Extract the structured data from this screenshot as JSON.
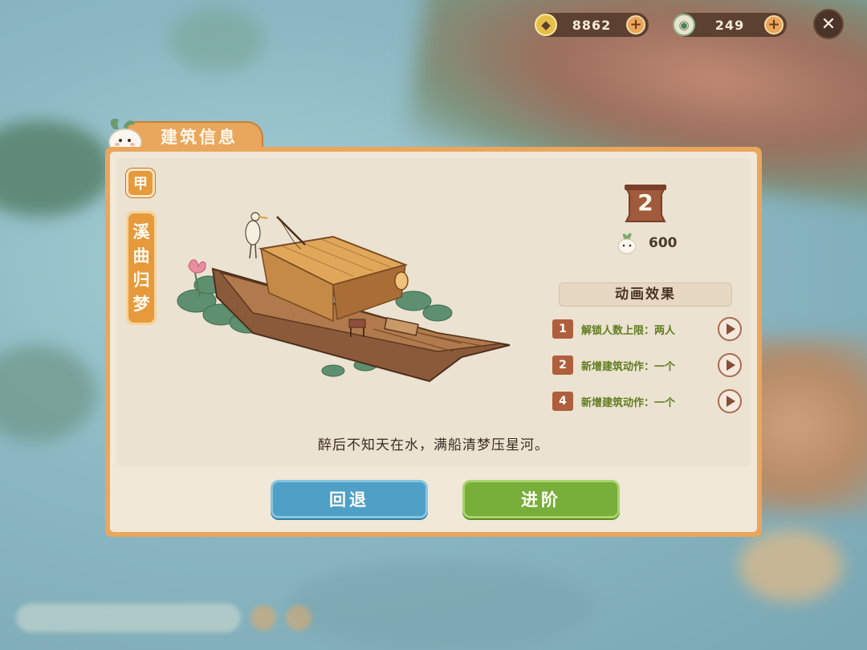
{
  "currency": {
    "coins": "8862",
    "jade": "249",
    "coin_icon": "coin-icon",
    "jade_icon": "jade-coin-icon",
    "plus_label": "+"
  },
  "close_icon": "close-icon",
  "panel": {
    "title": "建筑信息",
    "grade": "甲",
    "name_chars": [
      "溪",
      "曲",
      "归",
      "梦"
    ],
    "level": "2",
    "cost": "600",
    "effects_title": "动画效果",
    "effects": [
      {
        "num": "1",
        "text": "解锁人数上限：两人"
      },
      {
        "num": "2",
        "text": "新增建筑动作：一个"
      },
      {
        "num": "4",
        "text": "新增建筑动作：一个"
      }
    ],
    "poem": "醉后不知天在水，满船清梦压星河。",
    "back_label": "回退",
    "advance_label": "进阶"
  },
  "colors": {
    "panel_border": "#e9a65d",
    "panel_bg": "#f1e8d8",
    "back_button": "#4fa0c7",
    "advance_button": "#78ae3a",
    "effect_text": "#5f7d1f",
    "effect_badge": "#b05f3c"
  }
}
